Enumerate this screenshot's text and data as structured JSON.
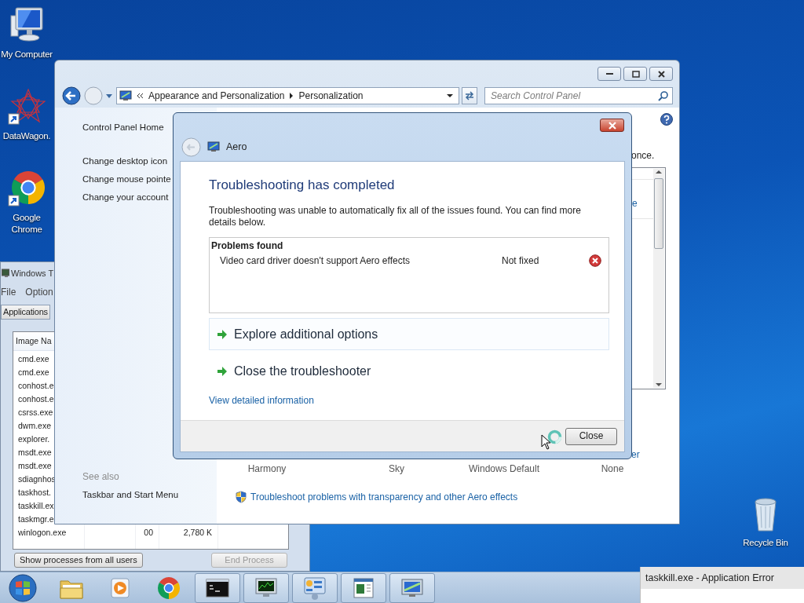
{
  "desktop_icons": [
    {
      "label": "My Computer",
      "kind": "computer"
    },
    {
      "label": "DataWagon.",
      "kind": "network"
    },
    {
      "label": "Google Chrome",
      "kind": "browser"
    },
    {
      "label": "Recycle Bin",
      "kind": "bin"
    }
  ],
  "task_manager": {
    "title": "Windows T",
    "menu": [
      "File",
      "Option"
    ],
    "tab": "Applications",
    "column": "Image Na",
    "rows": [
      {
        "name": "cmd.exe"
      },
      {
        "name": "cmd.exe"
      },
      {
        "name": "conhost.e"
      },
      {
        "name": "conhost.e"
      },
      {
        "name": "csrss.exe"
      },
      {
        "name": "dwm.exe"
      },
      {
        "name": "explorer."
      },
      {
        "name": "msdt.exe"
      },
      {
        "name": "msdt.exe"
      },
      {
        "name": "sdiagnhos"
      },
      {
        "name": "taskhost."
      },
      {
        "name": "taskkill.ex"
      },
      {
        "name": "taskmgr.e"
      },
      {
        "name": "winlogon.exe",
        "cpu": "00",
        "memory": "2,780 K"
      }
    ],
    "buttons": [
      {
        "label": "Show processes from all users",
        "disabled": false
      },
      {
        "label": "End Process",
        "disabled": true
      }
    ]
  },
  "control_panel": {
    "breadcrumb": [
      "Appearance and Personalization",
      "Personalization"
    ],
    "search": {
      "placeholder": "Search Control Panel"
    },
    "home": "Control Panel Home",
    "links": [
      "Change desktop icon",
      "Change mouse pointe",
      "Change your account"
    ],
    "see_also": "See also",
    "see_also_links": [
      "Taskbar and Start Menu"
    ],
    "fragments": [
      "once.",
      "e",
      "er"
    ],
    "themes": [
      "Harmony",
      "Sky",
      "Windows Default",
      "None"
    ],
    "troubleshoot_link": "Troubleshoot problems with transparency and other Aero effects"
  },
  "dialog": {
    "title": "Aero",
    "heading": "Troubleshooting has completed",
    "message": "Troubleshooting was unable to automatically fix all of the issues found. You can find more details below.",
    "problems_heading": "Problems found",
    "problems": [
      {
        "description": "Video card driver doesn't support Aero effects",
        "status": "Not fixed",
        "fixed": false
      }
    ],
    "options": [
      {
        "label": "Explore additional options",
        "selected": true
      },
      {
        "label": "Close the troubleshooter",
        "selected": false
      }
    ],
    "details_link": "View detailed information",
    "button": "Close"
  },
  "taskbar": {
    "items": [
      {
        "kind": "start",
        "running": false
      },
      {
        "kind": "folder",
        "running": false
      },
      {
        "kind": "media",
        "running": false
      },
      {
        "kind": "browser",
        "running": false
      },
      {
        "kind": "console",
        "running": true
      },
      {
        "kind": "monitor",
        "running": true
      },
      {
        "kind": "panel",
        "running": true
      },
      {
        "kind": "document",
        "running": true
      },
      {
        "kind": "display",
        "running": true
      }
    ]
  },
  "error_window": {
    "title": "taskkill.exe - Application Error"
  }
}
